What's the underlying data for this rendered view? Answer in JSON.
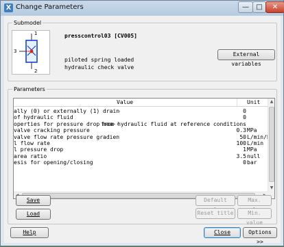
{
  "window": {
    "title": "Change Parameters",
    "app_icon": "X"
  },
  "submodel": {
    "group_label": "Submodel",
    "name": "presscontrol03 [CV005]",
    "description_line1": "piloted spring loaded",
    "description_line2": "hydraulic check valve",
    "external_variables_label": "External variables",
    "port_label_top": "1",
    "port_label_left": "3",
    "port_label_bottom": "2"
  },
  "parameters": {
    "group_label": "Parameters",
    "columns": {
      "value": "Value",
      "unit": "Unit"
    },
    "rows": [
      {
        "title": "ally (0) or externally (1) drained",
        "value": "0",
        "unit": ""
      },
      {
        "title": "of hydraulic fluid",
        "value": "0",
        "unit": ""
      },
      {
        "title": "operties for pressure drop mea···",
        "value": "from hydraulic fluid at reference conditions",
        "unit": ""
      },
      {
        "title": "valve cracking pressure",
        "value": "0.3",
        "unit": "MPa"
      },
      {
        "title": "valve flow rate pressure gradient",
        "value": "50",
        "unit": "L/min/bar"
      },
      {
        "title": "l flow rate",
        "value": "100",
        "unit": "L/min"
      },
      {
        "title": "l pressure drop",
        "value": "1",
        "unit": "MPa"
      },
      {
        "title": "area ratio",
        "value": "3.5",
        "unit": "null"
      },
      {
        "title": "esis for opening/closing",
        "value": "0",
        "unit": "bar"
      }
    ]
  },
  "buttons": {
    "save": "Save",
    "load": "Load",
    "default_value": "Default value",
    "max_value": "Max. value",
    "reset_title": "Reset title",
    "min_value": "Min. value",
    "help": "Help",
    "close": "Close",
    "options": "Options >>"
  }
}
